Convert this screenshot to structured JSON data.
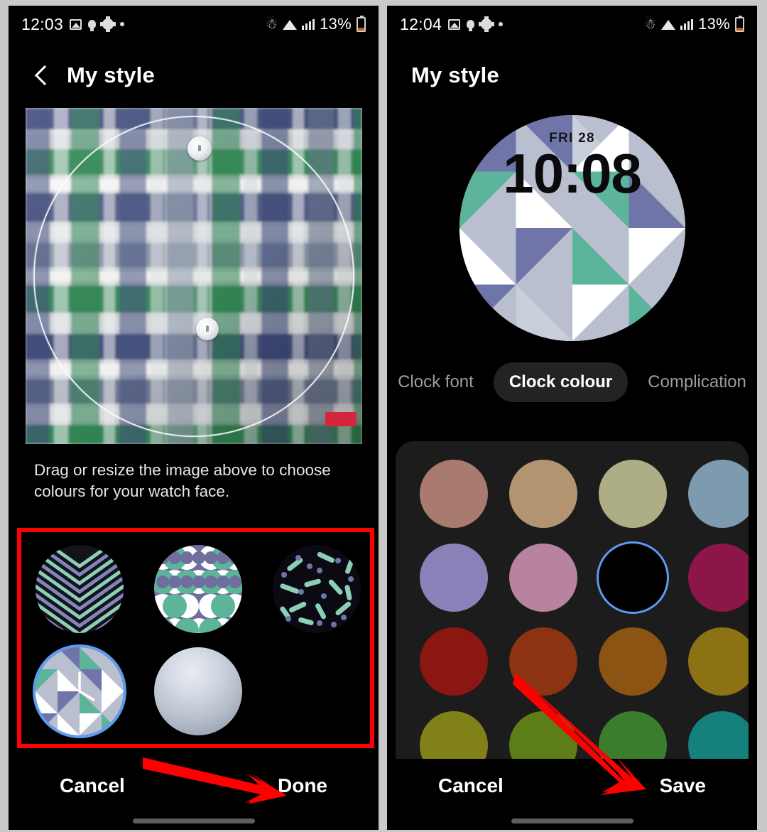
{
  "panels": {
    "left": {
      "statusbar": {
        "time": "12:03",
        "battery": "13%",
        "icons": [
          "photo-icon",
          "bulb-icon",
          "gear-icon",
          "dot-icon",
          "bluetooth-icon",
          "wifi-icon",
          "signal-icon",
          "battery-icon"
        ]
      },
      "header": {
        "title": "My style",
        "back_icon": "chevron-left-icon"
      },
      "hint": "Drag or resize the image above to choose colours for your watch face.",
      "photo": {
        "alt": "green and navy plaid shirt with buttons",
        "crop_shape": "circle"
      },
      "thumbnails": [
        {
          "name": "chevron-pattern",
          "label": "Chevron",
          "selected": false
        },
        {
          "name": "scallop-pattern",
          "label": "Scallop",
          "selected": false
        },
        {
          "name": "confetti-pattern",
          "label": "Confetti",
          "selected": false
        },
        {
          "name": "triangle-pattern",
          "label": "Triangles",
          "selected": true
        },
        {
          "name": "gradient-sphere",
          "label": "Gradient",
          "selected": false
        }
      ],
      "buttons": {
        "cancel": "Cancel",
        "primary": "Done"
      }
    },
    "right": {
      "statusbar": {
        "time": "12:04",
        "battery": "13%"
      },
      "header": {
        "title": "My style"
      },
      "watch": {
        "date": "FRI 28",
        "time": "10:08"
      },
      "tabs": [
        {
          "label": "Clock font",
          "active": false
        },
        {
          "label": "Clock colour",
          "active": true
        },
        {
          "label": "Complication",
          "active": false
        }
      ],
      "colors": [
        {
          "hex": "#a97a70",
          "selected": false
        },
        {
          "hex": "#b39470",
          "selected": false
        },
        {
          "hex": "#aeae86",
          "selected": false
        },
        {
          "hex": "#7e9aae",
          "selected": false
        },
        {
          "hex": "#8a81b8",
          "selected": false
        },
        {
          "hex": "#b8839f",
          "selected": false
        },
        {
          "hex": "#000000",
          "selected": true
        },
        {
          "hex": "#8c1647",
          "selected": false
        },
        {
          "hex": "#8c1612",
          "selected": false
        },
        {
          "hex": "#8c3412",
          "selected": false
        },
        {
          "hex": "#8c5412",
          "selected": false
        },
        {
          "hex": "#8c7212",
          "selected": false
        },
        {
          "hex": "#81811a",
          "selected": false
        },
        {
          "hex": "#5d7d16",
          "selected": false
        },
        {
          "hex": "#3a7d2c",
          "selected": false
        },
        {
          "hex": "#15807c",
          "selected": false
        }
      ],
      "buttons": {
        "cancel": "Cancel",
        "primary": "Save"
      }
    }
  },
  "annotations": {
    "highlight_box_color": "#ff0000",
    "arrow_color": "#ff0000",
    "arrow_left_target": "Done",
    "arrow_right_target": "Save"
  }
}
